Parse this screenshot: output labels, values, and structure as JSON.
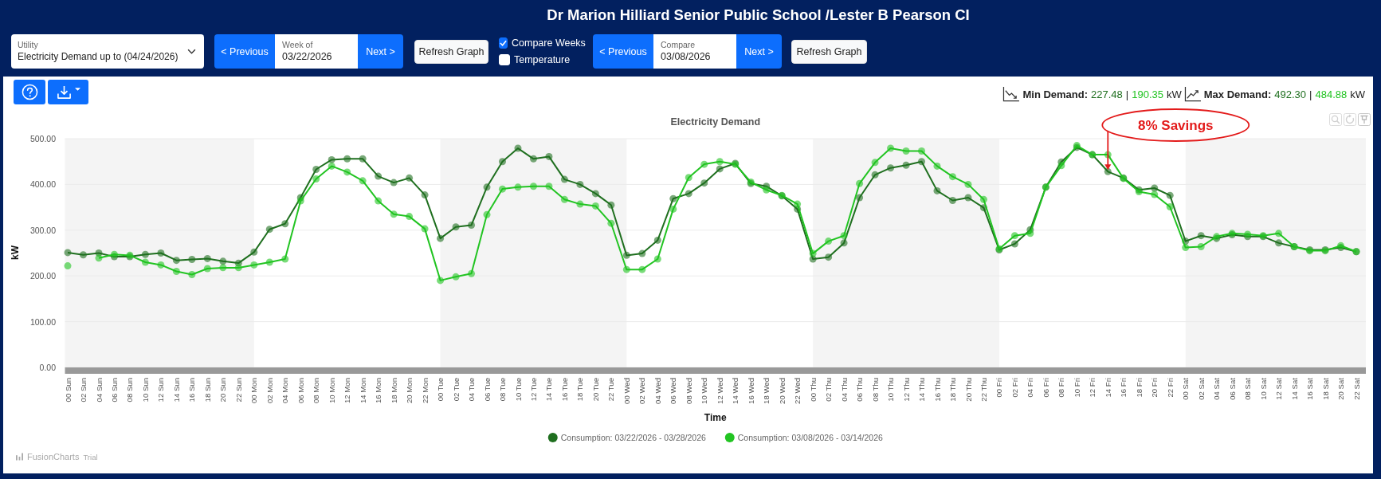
{
  "header": {
    "title": "Dr Marion Hilliard Senior Public School /Lester B Pearson CI"
  },
  "controls": {
    "utility": {
      "label": "Utility",
      "value": "Electricity Demand up to (04/24/2026)"
    },
    "week": {
      "previous": "< Previous",
      "label": "Week of",
      "value": "03/22/2026",
      "next": "Next >",
      "refresh": "Refresh Graph"
    },
    "options": [
      {
        "label": "Compare Weeks",
        "checked": true
      },
      {
        "label": "Temperature",
        "checked": false
      }
    ],
    "compare": {
      "previous": "< Previous",
      "label": "Compare",
      "value": "03/08/2026",
      "next": "Next >",
      "refresh": "Refresh Graph"
    }
  },
  "summary": [
    {
      "kind": "min",
      "label": "Min Demand:",
      "readings": [
        {
          "value": "227.48",
          "color": "#1f6f1f"
        },
        {
          "value": "190.35",
          "color": "#22c422"
        }
      ],
      "separator": "|",
      "unit": "kW"
    },
    {
      "kind": "max",
      "label": "Max Demand:",
      "readings": [
        {
          "value": "492.30",
          "color": "#1f6f1f"
        },
        {
          "value": "484.88",
          "color": "#22c422"
        }
      ],
      "separator": "|",
      "unit": "kW"
    }
  ],
  "chart": {
    "chart_data": {
      "type": "line",
      "title": "Electricity Demand",
      "xlabel": "Time",
      "ylabel": "kW",
      "categories": [
        "00 Sun",
        "02 Sun",
        "04 Sun",
        "06 Sun",
        "08 Sun",
        "10 Sun",
        "12 Sun",
        "14 Sun",
        "16 Sun",
        "18 Sun",
        "20 Sun",
        "22 Sun",
        "00 Mon",
        "02 Mon",
        "04 Mon",
        "06 Mon",
        "08 Mon",
        "10 Mon",
        "12 Mon",
        "14 Mon",
        "16 Mon",
        "18 Mon",
        "20 Mon",
        "22 Mon",
        "00 Tue",
        "02 Tue",
        "04 Tue",
        "06 Tue",
        "08 Tue",
        "10 Tue",
        "12 Tue",
        "14 Tue",
        "16 Tue",
        "18 Tue",
        "20 Tue",
        "22 Tue",
        "00 Wed",
        "02 Wed",
        "04 Wed",
        "06 Wed",
        "08 Wed",
        "10 Wed",
        "12 Wed",
        "14 Wed",
        "16 Wed",
        "18 Wed",
        "20 Wed",
        "22 Wed",
        "00 Thu",
        "02 Thu",
        "04 Thu",
        "06 Thu",
        "08 Thu",
        "10 Thu",
        "12 Thu",
        "14 Thu",
        "16 Thu",
        "18 Thu",
        "20 Thu",
        "22 Thu",
        "00 Fri",
        "02 Fri",
        "04 Fri",
        "06 Fri",
        "08 Fri",
        "10 Fri",
        "12 Fri",
        "14 Fri",
        "16 Fri",
        "18 Fri",
        "20 Fri",
        "22 Fri",
        "00 Sat",
        "02 Sat",
        "04 Sat",
        "06 Sat",
        "08 Sat",
        "10 Sat",
        "12 Sat",
        "14 Sat",
        "16 Sat",
        "18 Sat",
        "20 Sat",
        "22 Sat"
      ],
      "series": [
        {
          "name": "Consumption: 03/22/2026 - 03/28/2026",
          "color": "#1f6f1f",
          "marker": "circle",
          "values": [
            251,
            246,
            250,
            242,
            242,
            247,
            250,
            234,
            236,
            238,
            232,
            228,
            252,
            302,
            314,
            371,
            433,
            454,
            456,
            456,
            418,
            404,
            414,
            377,
            282,
            307,
            311,
            394,
            450,
            479,
            456,
            461,
            411,
            400,
            380,
            355,
            245,
            249,
            278,
            369,
            380,
            403,
            434,
            446,
            402,
            396,
            375,
            346,
            237,
            241,
            272,
            371,
            421,
            436,
            442,
            450,
            386,
            365,
            371,
            349,
            257,
            270,
            301,
            394,
            449,
            481,
            465,
            428,
            414,
            388,
            392,
            376,
            276,
            288,
            282,
            290,
            286,
            286,
            272,
            264,
            257,
            257,
            262,
            253
          ]
        },
        {
          "name": "Consumption: 03/08/2026 - 03/14/2026",
          "color": "#22c422",
          "marker": "circle",
          "values": [
            222,
            null,
            239,
            247,
            245,
            230,
            224,
            210,
            203,
            216,
            218,
            218,
            224,
            230,
            237,
            364,
            412,
            440,
            427,
            408,
            364,
            335,
            330,
            303,
            190,
            198,
            205,
            334,
            390,
            394,
            396,
            396,
            367,
            357,
            353,
            315,
            214,
            214,
            237,
            346,
            415,
            444,
            450,
            444,
            405,
            388,
            376,
            357,
            249,
            276,
            288,
            402,
            448,
            479,
            473,
            473,
            440,
            417,
            400,
            367,
            259,
            288,
            293,
            394,
            441,
            485,
            465,
            465,
            413,
            384,
            378,
            351,
            262,
            264,
            286,
            293,
            291,
            288,
            293,
            264,
            255,
            255,
            266,
            253
          ]
        }
      ],
      "ylim": [
        0,
        500
      ],
      "yticks": [
        {
          "value": 0,
          "label": "0.00"
        },
        {
          "value": 100,
          "label": "100.00"
        },
        {
          "value": 200,
          "label": "200.00"
        },
        {
          "value": 300,
          "label": "300.00"
        },
        {
          "value": 400,
          "label": "400.00"
        },
        {
          "value": 500,
          "label": "500.00"
        }
      ],
      "grid": true,
      "legend": "bottom",
      "annotations": [
        "8% Savings"
      ]
    }
  },
  "credit": {
    "name": "FusionCharts",
    "edition": "Trial"
  }
}
